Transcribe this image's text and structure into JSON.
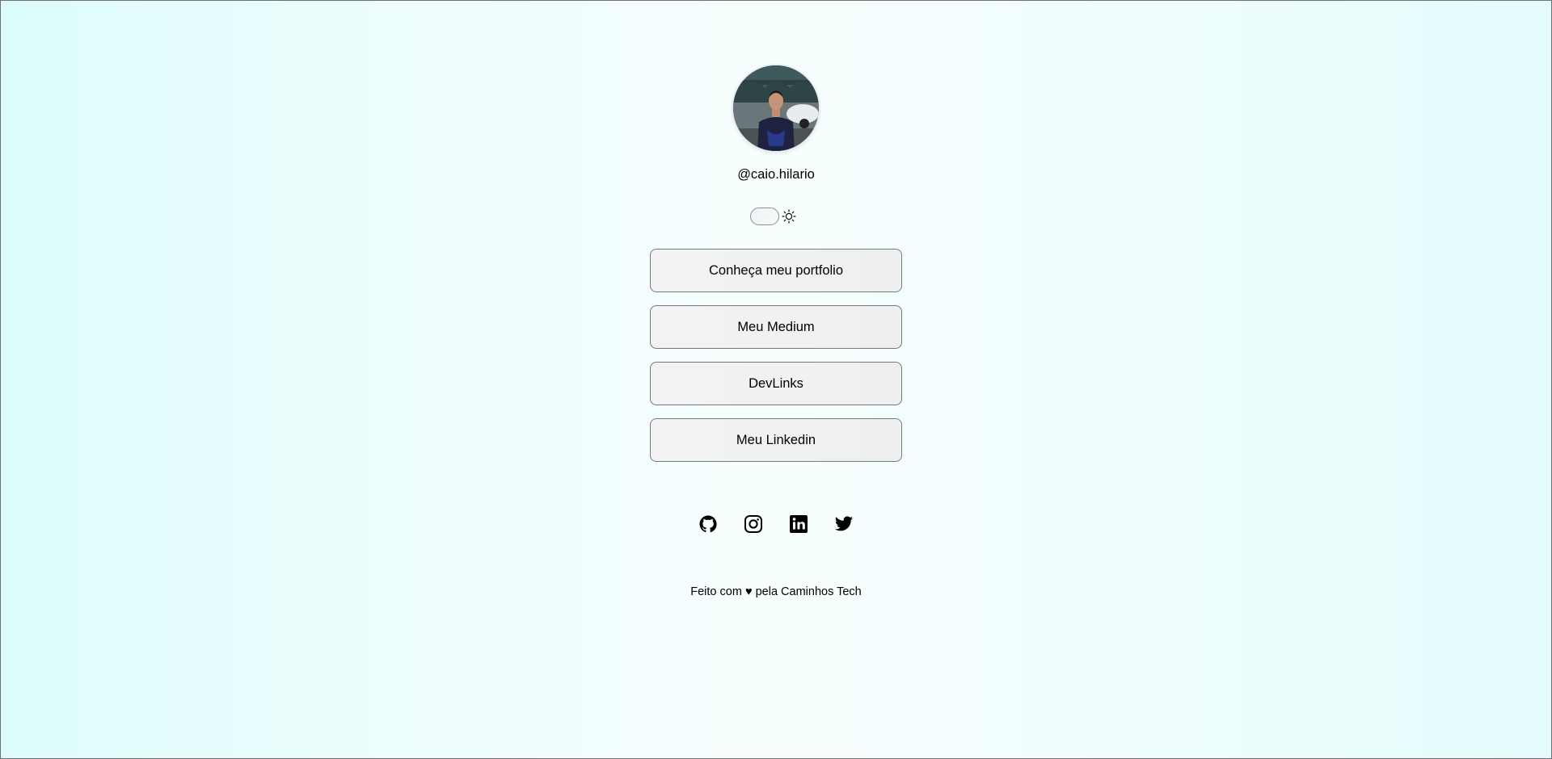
{
  "profile": {
    "username": "@caio.hilario",
    "avatar_icon": "profile-photo"
  },
  "theme_toggle": {
    "icon": "sun-icon",
    "state": "off"
  },
  "links": [
    {
      "label": "Conheça meu portfolio"
    },
    {
      "label": "Meu Medium"
    },
    {
      "label": "DevLinks"
    },
    {
      "label": "Meu Linkedin"
    }
  ],
  "social_icons": [
    "github-icon",
    "instagram-icon",
    "linkedin-icon",
    "twitter-icon"
  ],
  "footer": {
    "prefix": "Feito com",
    "heart": "♥",
    "suffix": "pela Caminhos Tech"
  },
  "colors": {
    "background_left": "#dcfcfc",
    "background_center": "#f7fefe",
    "button_border": "#75797c",
    "button_bg": "#f2f2f2",
    "text": "#000000"
  }
}
